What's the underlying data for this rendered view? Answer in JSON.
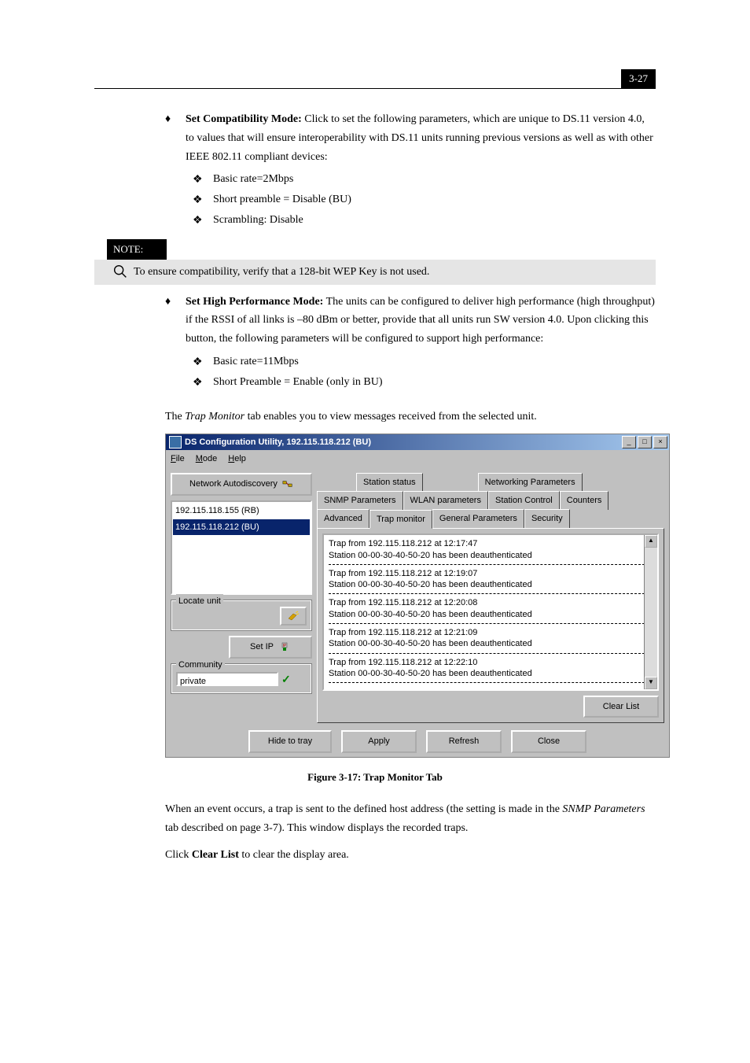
{
  "page_number": "3-27",
  "bullets": {
    "set_compat_title": "Set Compatibility Mode:",
    "set_compat_text": " Click to set the following parameters, which are unique to DS.11 version 4.0, to values that will ensure interoperability with DS.11 units running previous versions as well as with other IEEE 802.11 compliant devices:",
    "sub1a": "Basic rate=2Mbps",
    "sub1b": "Short preamble = Disable (BU)",
    "sub1c": "Scrambling: Disable",
    "set_high_title": "Set High Performance Mode:",
    "set_high_text": " The units can be configured to deliver high performance (high throughput) if the RSSI of all links is –80 dBm or better, provide that all units run SW version 4.0. Upon clicking this button, the following parameters will be configured to support high performance:",
    "sub2a": "Basic rate=11Mbps",
    "sub2b": "Short Preamble = Enable (only in BU)"
  },
  "note": {
    "label": "NOTE:",
    "text": "To ensure compatibility, verify that a 128-bit WEP Key is not used."
  },
  "trap_intro_pre": "The ",
  "trap_intro_italic": "Trap Monitor",
  "trap_intro_post": " tab enables you to view messages received from the selected unit.",
  "figure_caption": "Figure 3-17: Trap Monitor Tab",
  "para2_a": "When an event occurs, a trap is sent to the defined host address (the setting is made in the ",
  "para2_italic": "SNMP Parameters",
  "para2_b": " tab described on page 3-7). This window displays the recorded traps.",
  "para3_a": "Click ",
  "para3_bold": "Clear List",
  "para3_b": " to clear the display area.",
  "screenshot": {
    "title": "DS Configuration Utility, 192.115.118.212 (BU)",
    "menu": {
      "file": "File",
      "mode": "Mode",
      "help": "Help"
    },
    "left": {
      "autodiscovery": "Network Autodiscovery",
      "list": [
        "192.115.118.155 (RB)",
        "192.115.118.212 (BU)"
      ],
      "selected_index": 1,
      "locate_label": "Locate unit",
      "setip": "Set IP",
      "community_label": "Community",
      "community_value": "private"
    },
    "tabs_row1": [
      "Station status",
      "Networking Parameters"
    ],
    "tabs_row2": [
      "SNMP Parameters",
      "WLAN parameters",
      "Station Control",
      "Counters"
    ],
    "tabs_row3": [
      "Advanced",
      "Trap monitor",
      "General Parameters",
      "Security"
    ],
    "active_tab": "Trap monitor",
    "traps": [
      {
        "l1": "Trap from 192.115.118.212 at 12:17:47",
        "l2": "Station 00-00-30-40-50-20 has been deauthenticated"
      },
      {
        "l1": "Trap from 192.115.118.212 at 12:19:07",
        "l2": "Station 00-00-30-40-50-20 has been deauthenticated"
      },
      {
        "l1": "Trap from 192.115.118.212 at 12:20:08",
        "l2": "Station 00-00-30-40-50-20 has been deauthenticated"
      },
      {
        "l1": "Trap from 192.115.118.212 at 12:21:09",
        "l2": "Station 00-00-30-40-50-20 has been deauthenticated"
      },
      {
        "l1": "Trap from 192.115.118.212 at 12:22:10",
        "l2": "Station 00-00-30-40-50-20 has been deauthenticated"
      }
    ],
    "buttons": {
      "clear_list": "Clear List",
      "hide": "Hide to tray",
      "apply": "Apply",
      "refresh": "Refresh",
      "close": "Close"
    }
  }
}
